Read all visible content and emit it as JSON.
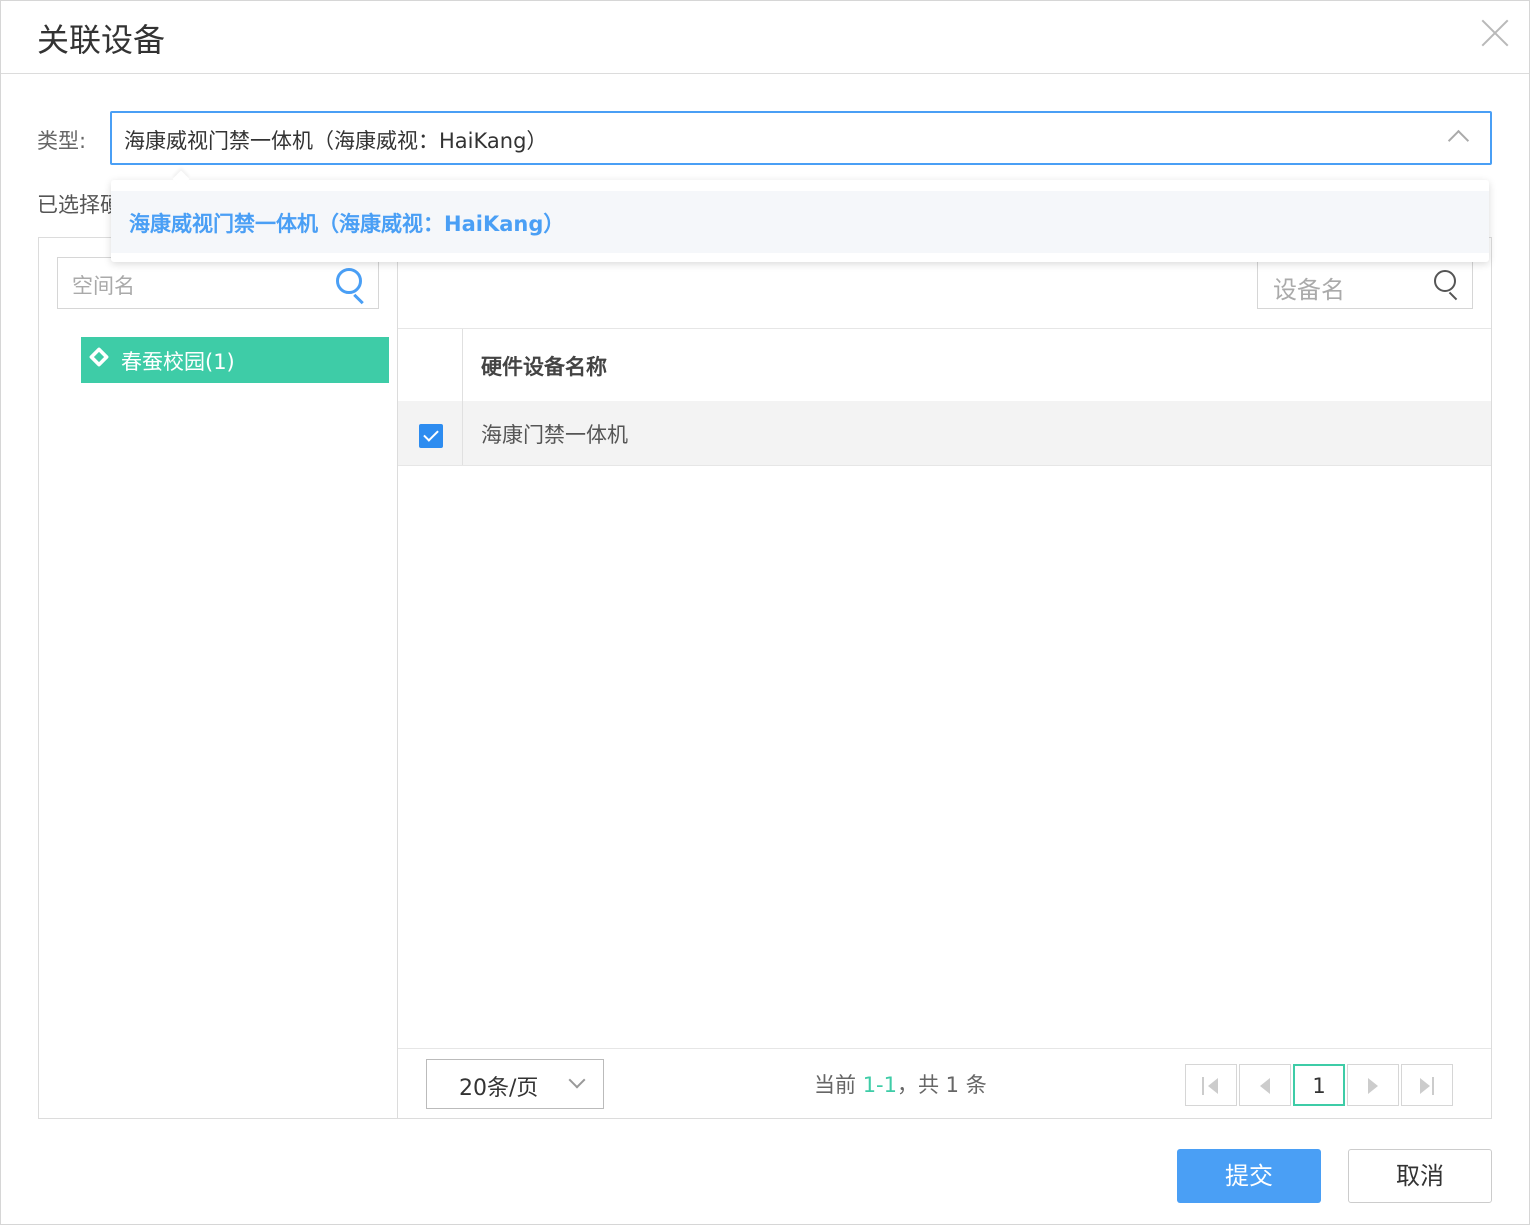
{
  "dialog": {
    "title": "关联设备"
  },
  "type_field": {
    "label": "类型:",
    "value": "海康威视门禁一体机（海康威视：HaiKang）",
    "options": [
      "海康威视门禁一体机（海康威视：HaiKang）"
    ]
  },
  "selected_label": "已选择硬",
  "space_search": {
    "placeholder": "空间名"
  },
  "tree": {
    "nodes": [
      {
        "label": "春蚕校园(1)"
      }
    ]
  },
  "device_search": {
    "placeholder": "设备名"
  },
  "table": {
    "columns": [
      "硬件设备名称"
    ],
    "rows": [
      {
        "checked": true,
        "name": "海康门禁一体机"
      }
    ]
  },
  "pagination": {
    "page_size": "20条/页",
    "info_prefix": "当前 ",
    "info_range": "1-1",
    "info_suffix": "，共 1 条",
    "current_page": "1"
  },
  "buttons": {
    "submit": "提交",
    "cancel": "取消"
  },
  "colors": {
    "accent": "#4a9ff5",
    "tree_selected": "#3ecca7",
    "checkbox": "#2d8cf0"
  }
}
